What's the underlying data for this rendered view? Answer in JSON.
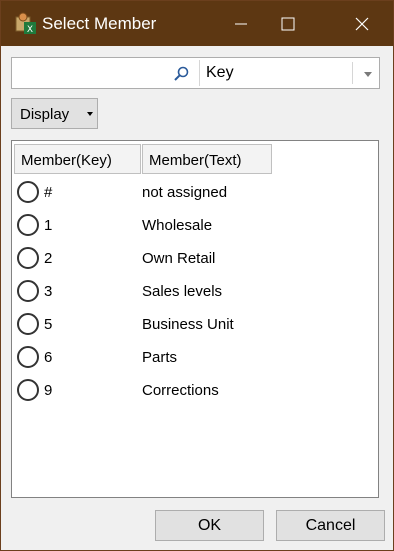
{
  "window": {
    "title": "Select Member"
  },
  "search": {
    "value": "",
    "placeholder": ""
  },
  "attribute_combo": {
    "selected": "Key"
  },
  "display_button": {
    "label": "Display"
  },
  "table": {
    "columns": [
      "Member(Key)",
      "Member(Text)"
    ],
    "rows": [
      {
        "key": "#",
        "text": "not assigned"
      },
      {
        "key": "1",
        "text": "Wholesale"
      },
      {
        "key": "2",
        "text": "Own Retail"
      },
      {
        "key": "3",
        "text": "Sales levels"
      },
      {
        "key": "5",
        "text": "Business Unit"
      },
      {
        "key": "6",
        "text": "Parts"
      },
      {
        "key": "9",
        "text": "Corrections"
      }
    ]
  },
  "footer": {
    "ok_label": "OK",
    "cancel_label": "Cancel"
  },
  "colors": {
    "titlebar": "#5d3712",
    "window_bg": "#f0f0f0",
    "button_bg": "#e1e1e1"
  },
  "icons": {
    "app": "excel-member-app-icon",
    "search": "search-icon",
    "dropdown": "chevron-down-icon",
    "minimize": "minimize-icon",
    "maximize": "maximize-icon",
    "close": "close-icon"
  }
}
